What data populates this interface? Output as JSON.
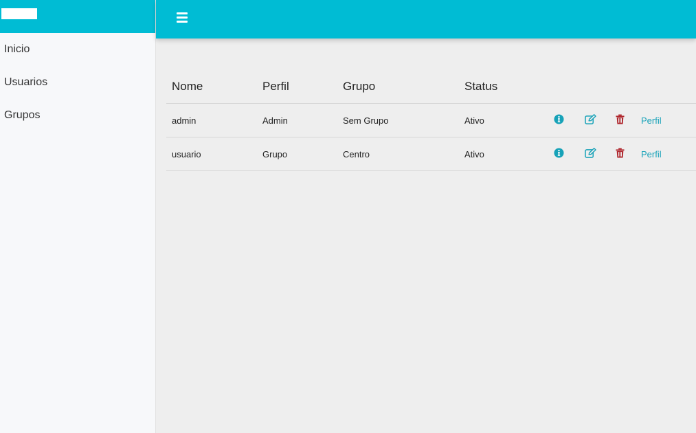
{
  "sidebar": {
    "items": [
      {
        "label": "Inicio"
      },
      {
        "label": "Usuarios"
      },
      {
        "label": "Grupos"
      }
    ]
  },
  "table": {
    "headers": [
      "Nome",
      "Perfil",
      "Grupo",
      "Status"
    ],
    "rows": [
      {
        "nome": "admin",
        "perfil": "Admin",
        "grupo": "Sem Grupo",
        "status": "Ativo",
        "link": "Perfil"
      },
      {
        "nome": "usuario",
        "perfil": "Grupo",
        "grupo": "Centro",
        "status": "Ativo",
        "link": "Perfil"
      }
    ]
  },
  "icons": {
    "info": "info-circle-icon",
    "edit": "edit-icon",
    "delete": "trash-icon",
    "menu": "hamburger-menu-icon"
  },
  "colors": {
    "brand": "#00bcd4",
    "action": "#17a2b8",
    "danger": "#b0282f"
  }
}
